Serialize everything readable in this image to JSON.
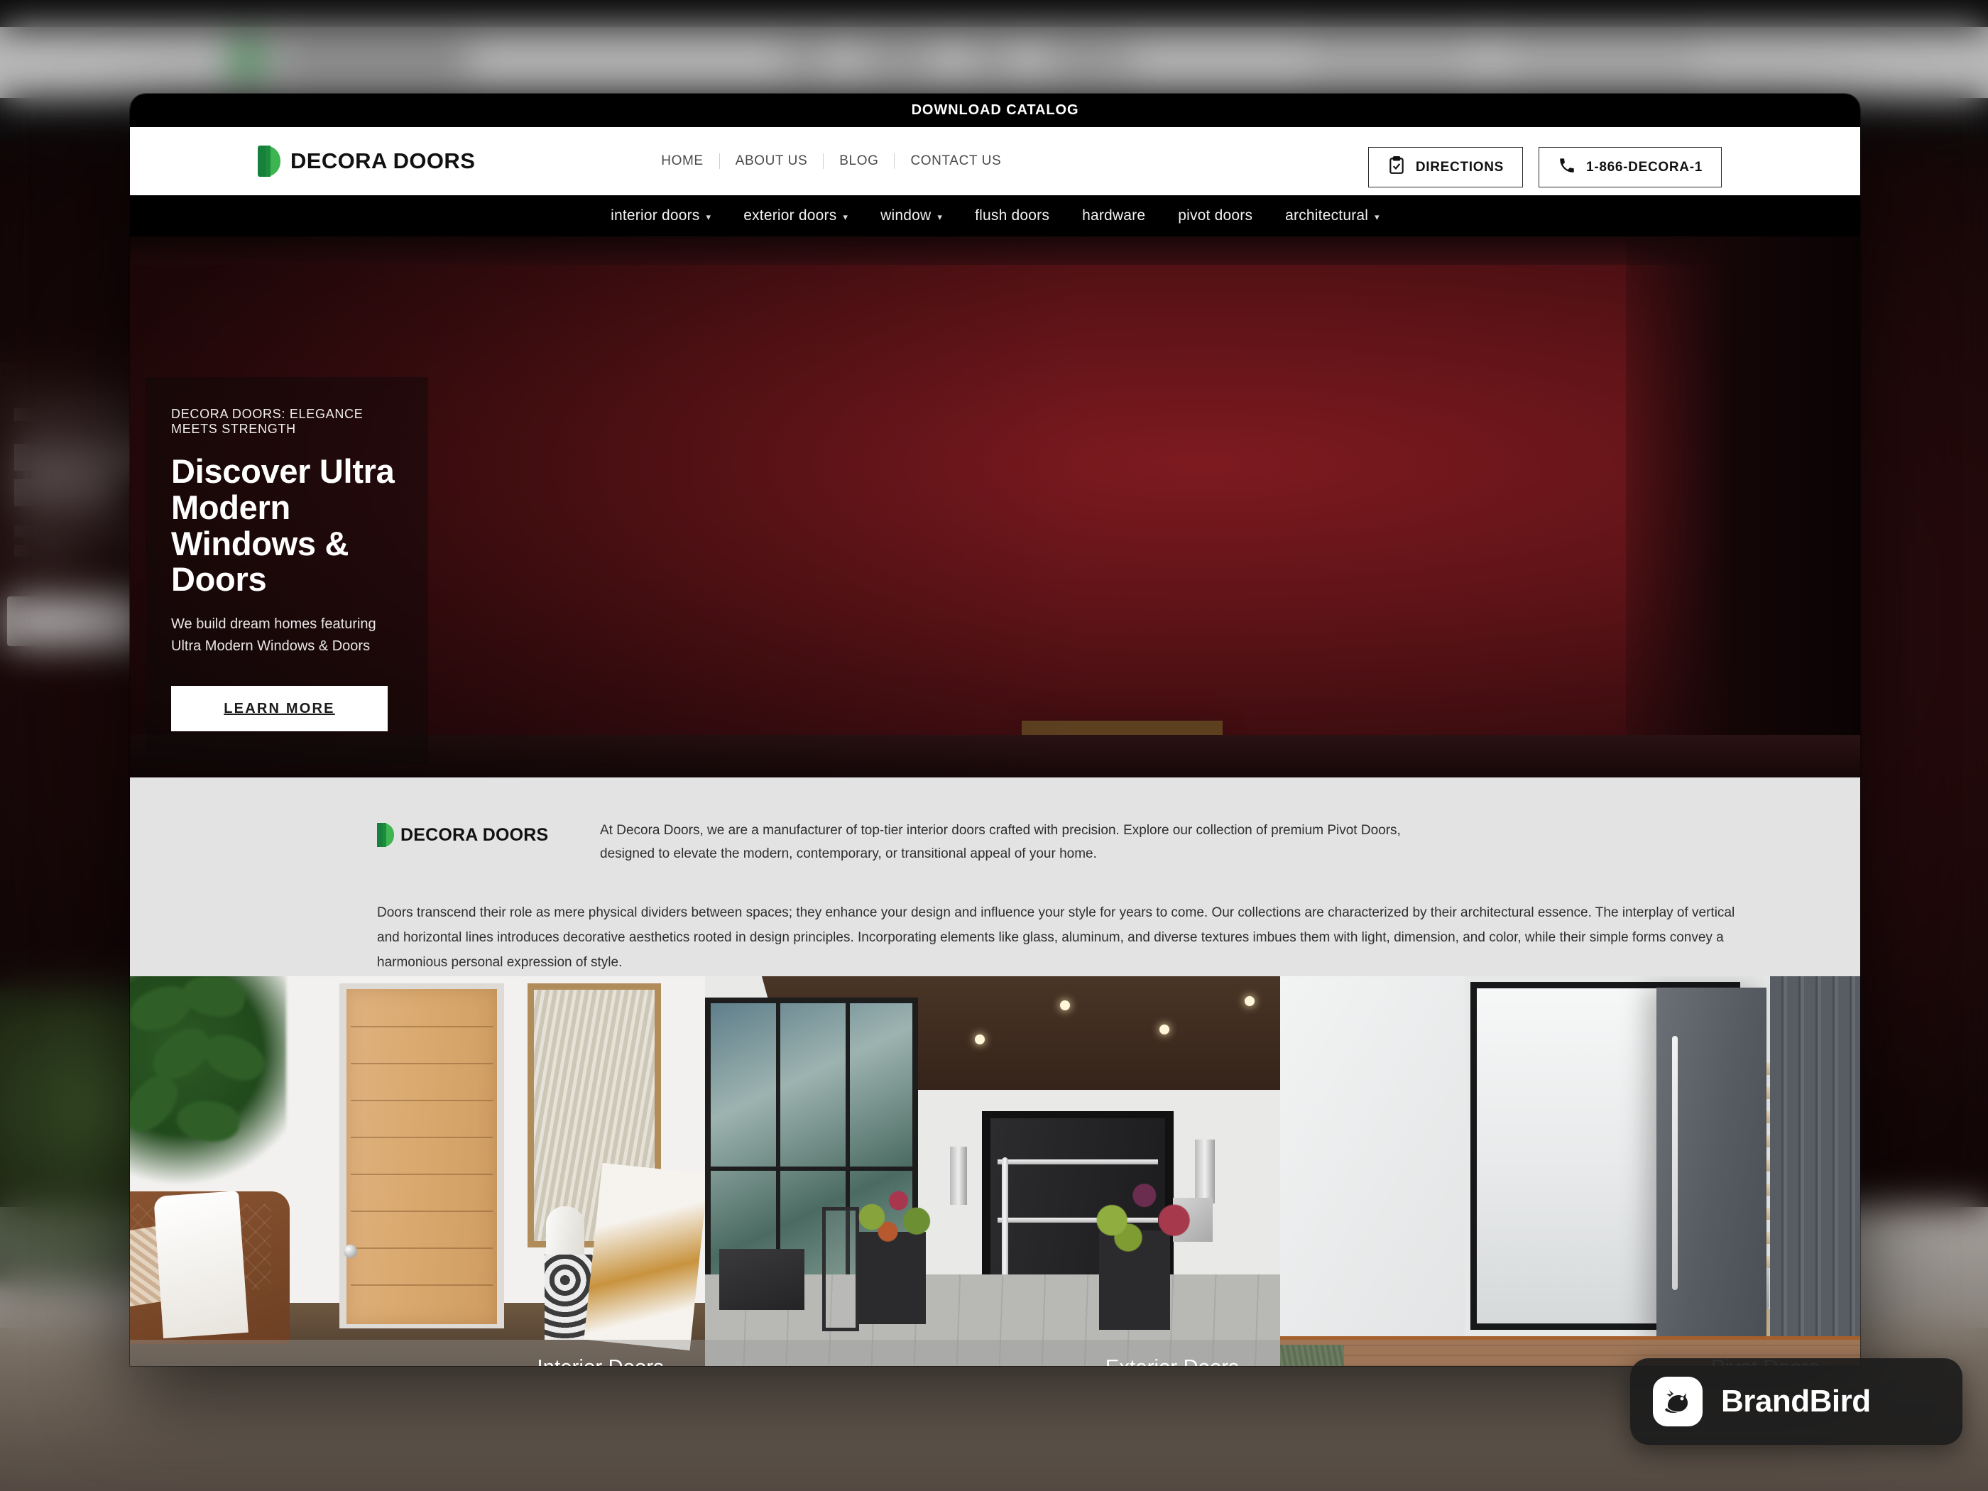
{
  "topbar": {
    "announcement": "DOWNLOAD CATALOG"
  },
  "header": {
    "brand_name": "DECORA DOORS",
    "nav": [
      {
        "label": "HOME"
      },
      {
        "label": "ABOUT US"
      },
      {
        "label": "BLOG"
      },
      {
        "label": "CONTACT US"
      }
    ],
    "directions_button": "DIRECTIONS",
    "phone_button": "1-866-DECORA-1",
    "icons": {
      "directions": "clipboard-check-icon",
      "phone": "phone-icon"
    }
  },
  "category_nav": [
    {
      "label": "interior doors",
      "has_dropdown": true
    },
    {
      "label": "exterior doors",
      "has_dropdown": true
    },
    {
      "label": "window",
      "has_dropdown": true
    },
    {
      "label": "flush doors",
      "has_dropdown": false
    },
    {
      "label": "hardware",
      "has_dropdown": false
    },
    {
      "label": "pivot doors",
      "has_dropdown": false
    },
    {
      "label": "architectural",
      "has_dropdown": true
    }
  ],
  "hero": {
    "eyebrow": "DECORA DOORS: ELEGANCE MEETS STRENGTH",
    "title": "Discover Ultra Modern Windows & Doors",
    "subtitle": "We build dream homes featuring Ultra Modern Windows & Doors",
    "cta": "LEARN MORE"
  },
  "intro": {
    "logo_text": "DECORA DOORS",
    "paragraph_1": "At Decora Doors, we are a manufacturer of top-tier interior doors crafted with precision. Explore our collection of premium Pivot Doors, designed to elevate the modern, contemporary, or transitional appeal of your home.",
    "paragraph_2": "Doors transcend their role as mere physical dividers between spaces; they enhance your design and influence your style for years to come. Our collections are characterized by their architectural essence. The interplay of vertical and horizontal lines introduces decorative aesthetics rooted in design principles. Incorporating elements like glass, aluminum, and diverse textures imbues them with light, dimension, and color, while their simple forms convey a harmonious personal expression of style."
  },
  "cards": [
    {
      "label": "Interior Doors"
    },
    {
      "label": "Exterior Doors"
    },
    {
      "label": "Pivot Doors"
    }
  ],
  "watermark": {
    "label": "BrandBird",
    "icon": "bird-logo-icon"
  },
  "colors": {
    "brand_green_dark": "#17803a",
    "brand_green_light": "#3eb550",
    "black": "#000000",
    "intro_background": "#e3e3e3",
    "hero_red": "#5d1317"
  }
}
